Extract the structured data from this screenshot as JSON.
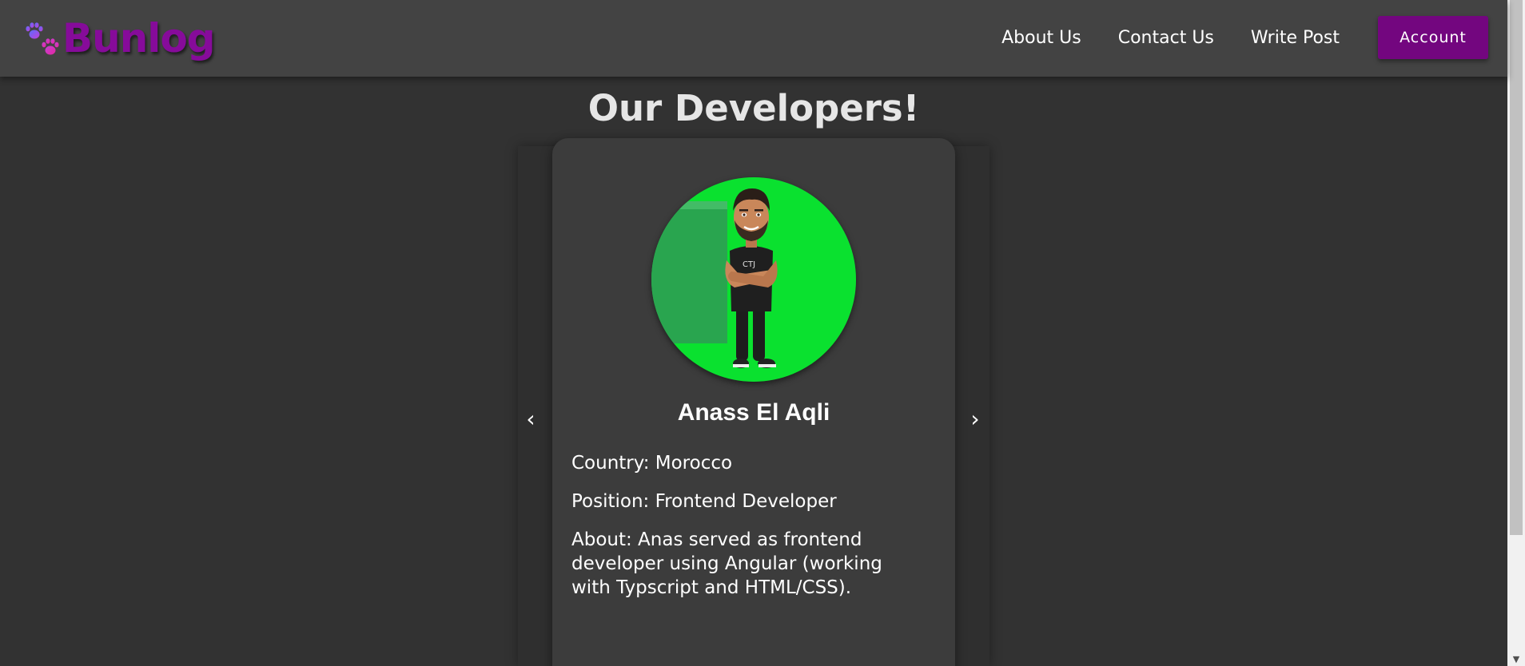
{
  "navbar": {
    "brand": "Bunlog",
    "links": [
      {
        "label": "About Us"
      },
      {
        "label": "Contact Us"
      },
      {
        "label": "Write Post"
      }
    ],
    "account_label": "Account"
  },
  "page": {
    "title": "Our Developers!"
  },
  "carousel": {
    "prev_symbol": "‹",
    "next_symbol": "›",
    "developer": {
      "name": "Anass El Aqli",
      "country": "Country: Morocco",
      "position": "Position: Frontend Developer",
      "about": "About: Anas served as frontend developer using Angular (working with Typscript and HTML/CSS)."
    }
  },
  "colors": {
    "page_background": "#323232",
    "navbar_background": "#434343",
    "brand": "#860b9a",
    "account_button": "#73067f",
    "card_background": "#3c3c3c",
    "avatar_background": "#0ae12f"
  },
  "icons": {
    "logo": "paw-prints-icon",
    "prev": "chevron-left-icon",
    "next": "chevron-right-icon",
    "scroll_down": "scroll-down-arrow-icon"
  }
}
